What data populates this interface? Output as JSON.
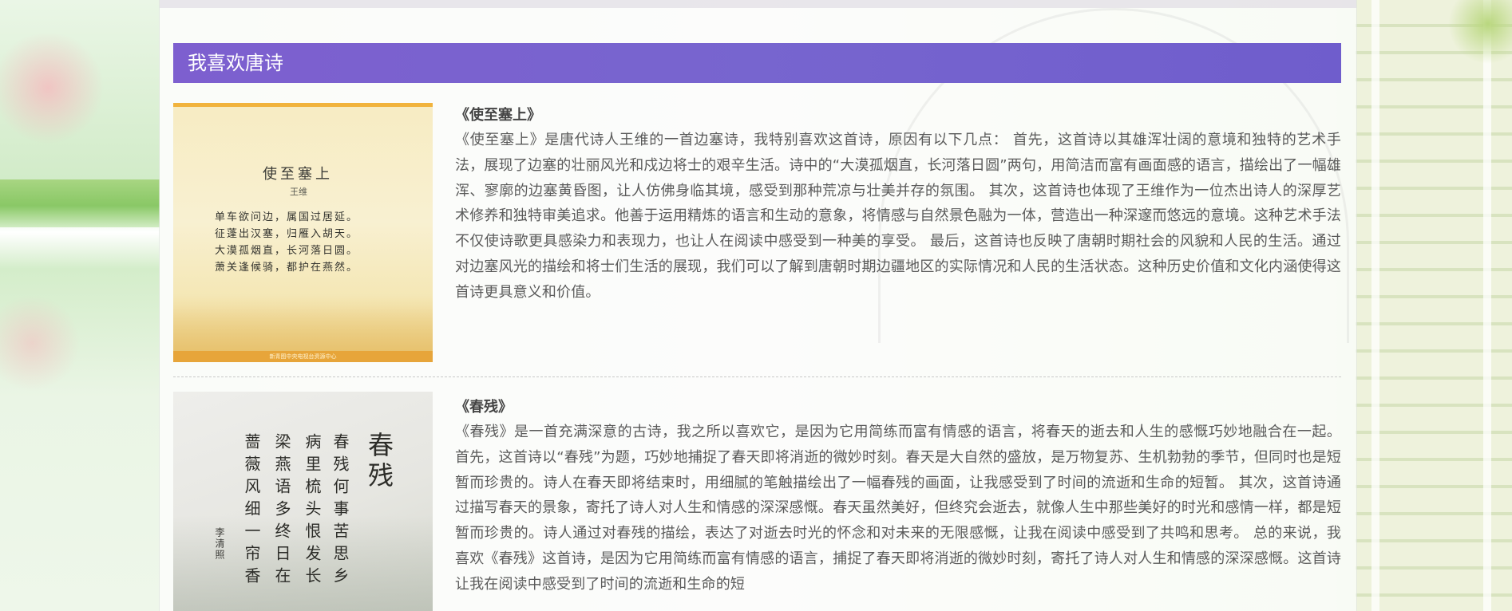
{
  "section": {
    "title": "我喜欢唐诗"
  },
  "poems": [
    {
      "name": "《使至塞上》",
      "image": {
        "title": "使至塞上",
        "author": "王维",
        "lines": [
          "单车欲问边，属国过居延。",
          "征蓬出汉塞，归雁入胡天。",
          "大漠孤烟直，长河落日圆。",
          "萧关逢候骑，都护在燕然。"
        ],
        "footer": "新青图中央电视台资源中心"
      },
      "description": "《使至塞上》是唐代诗人王维的一首边塞诗，我特别喜欢这首诗，原因有以下几点： 首先，这首诗以其雄浑壮阔的意境和独特的艺术手法，展现了边塞的壮丽风光和戍边将士的艰辛生活。诗中的“大漠孤烟直，长河落日圆”两句，用简洁而富有画面感的语言，描绘出了一幅雄浑、寥廓的边塞黄昏图，让人仿佛身临其境，感受到那种荒凉与壮美并存的氛围。 其次，这首诗也体现了王维作为一位杰出诗人的深厚艺术修养和独特审美追求。他善于运用精炼的语言和生动的意象，将情感与自然景色融为一体，营造出一种深邃而悠远的意境。这种艺术手法不仅使诗歌更具感染力和表现力，也让人在阅读中感受到一种美的享受。 最后，这首诗也反映了唐朝时期社会的风貌和人民的生活。通过对边塞风光的描绘和将士们生活的展现，我们可以了解到唐朝时期边疆地区的实际情况和人民的生活状态。这种历史价值和文化内涵使得这首诗更具意义和价值。"
    },
    {
      "name": "《春残》",
      "image": {
        "title": "春残",
        "columns": [
          "春残何事苦思乡",
          "病里梳头恨发长",
          "梁燕语多终日在",
          "蔷薇风细一帘香"
        ],
        "author": "李清照"
      },
      "description": "《春残》是一首充满深意的古诗，我之所以喜欢它，是因为它用简练而富有情感的语言，将春天的逝去和人生的感慨巧妙地融合在一起。 首先，这首诗以“春残”为题，巧妙地捕捉了春天即将消逝的微妙时刻。春天是大自然的盛放，是万物复苏、生机勃勃的季节，但同时也是短暂而珍贵的。诗人在春天即将结束时，用细腻的笔触描绘出了一幅春残的画面，让我感受到了时间的流逝和生命的短暂。 其次，这首诗通过描写春天的景象，寄托了诗人对人生和情感的深深感慨。春天虽然美好，但终究会逝去，就像人生中那些美好的时光和感情一样，都是短暂而珍贵的。诗人通过对春残的描绘，表达了对逝去时光的怀念和对未来的无限感慨，让我在阅读中感受到了共鸣和思考。 总的来说，我喜欢《春残》这首诗，是因为它用简练而富有情感的语言，捕捉了春天即将消逝的微妙时刻，寄托了诗人对人生和情感的深深感慨。这首诗让我在阅读中感受到了时间的流逝和生命的短"
    }
  ]
}
